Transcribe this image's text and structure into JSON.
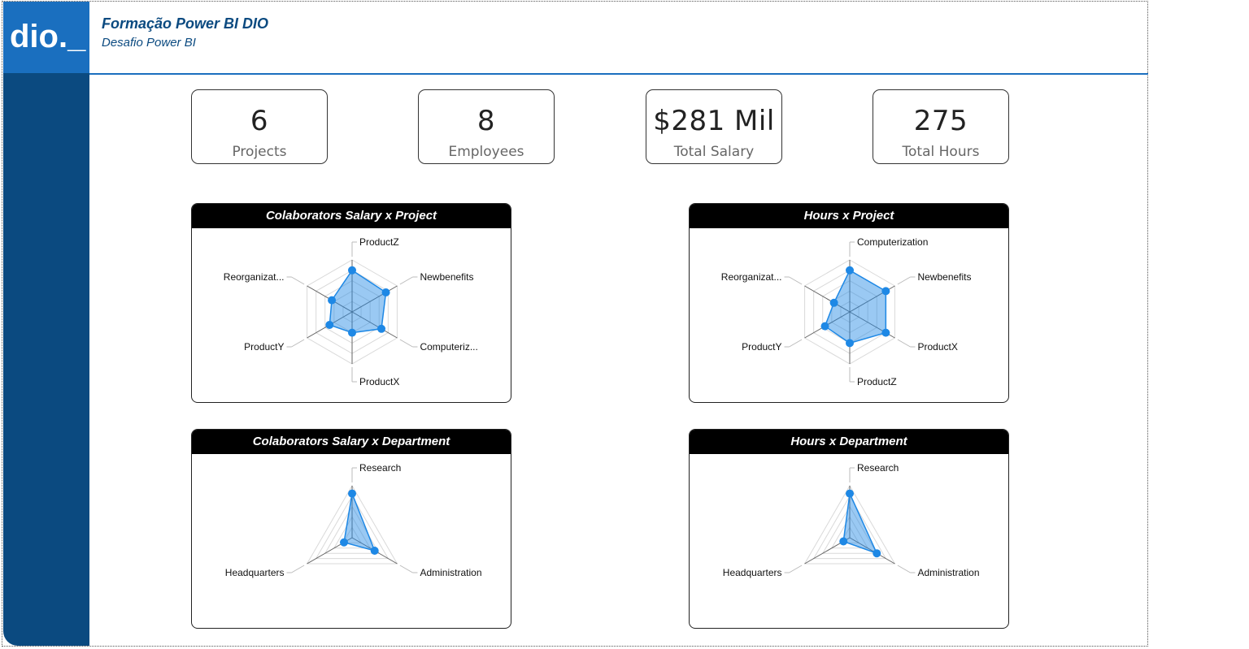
{
  "header": {
    "title": "Formação Power BI DIO",
    "subtitle": "Desafio Power BI",
    "logo_text": "dio._"
  },
  "colors": {
    "accent": "#1a6fbf",
    "sidebar": "#0b4a80",
    "series": "#1e88e5"
  },
  "kpis": [
    {
      "value": "6",
      "label": "Projects"
    },
    {
      "value": "8",
      "label": "Employees"
    },
    {
      "value": "$281 Mil",
      "label": "Total Salary"
    },
    {
      "value": "275",
      "label": "Total Hours"
    }
  ],
  "charts": [
    {
      "title": "Colaborators Salary x Project"
    },
    {
      "title": "Hours x Project"
    },
    {
      "title": "Colaborators Salary x Department"
    },
    {
      "title": "Hours x Department"
    }
  ],
  "chart_data": [
    {
      "type": "radar",
      "title": "Colaborators Salary x Project",
      "categories": [
        "ProductZ",
        "Newbenefits",
        "Computeriz...",
        "ProductX",
        "ProductY",
        "Reorganizat..."
      ],
      "values": [
        0.8,
        0.75,
        0.65,
        0.4,
        0.5,
        0.45
      ],
      "grid": true
    },
    {
      "type": "radar",
      "title": "Hours x Project",
      "categories": [
        "Computerization",
        "Newbenefits",
        "ProductX",
        "ProductZ",
        "ProductY",
        "Reorganizat..."
      ],
      "values": [
        0.8,
        0.8,
        0.8,
        0.6,
        0.55,
        0.35
      ],
      "grid": true
    },
    {
      "type": "radar",
      "title": "Colaborators Salary x Department",
      "categories": [
        "Research",
        "Administration",
        "Headquarters"
      ],
      "values": [
        0.85,
        0.5,
        0.18
      ],
      "grid": true
    },
    {
      "type": "radar",
      "title": "Hours x Department",
      "categories": [
        "Research",
        "Administration",
        "Headquarters"
      ],
      "values": [
        0.85,
        0.6,
        0.14
      ],
      "grid": true
    }
  ]
}
